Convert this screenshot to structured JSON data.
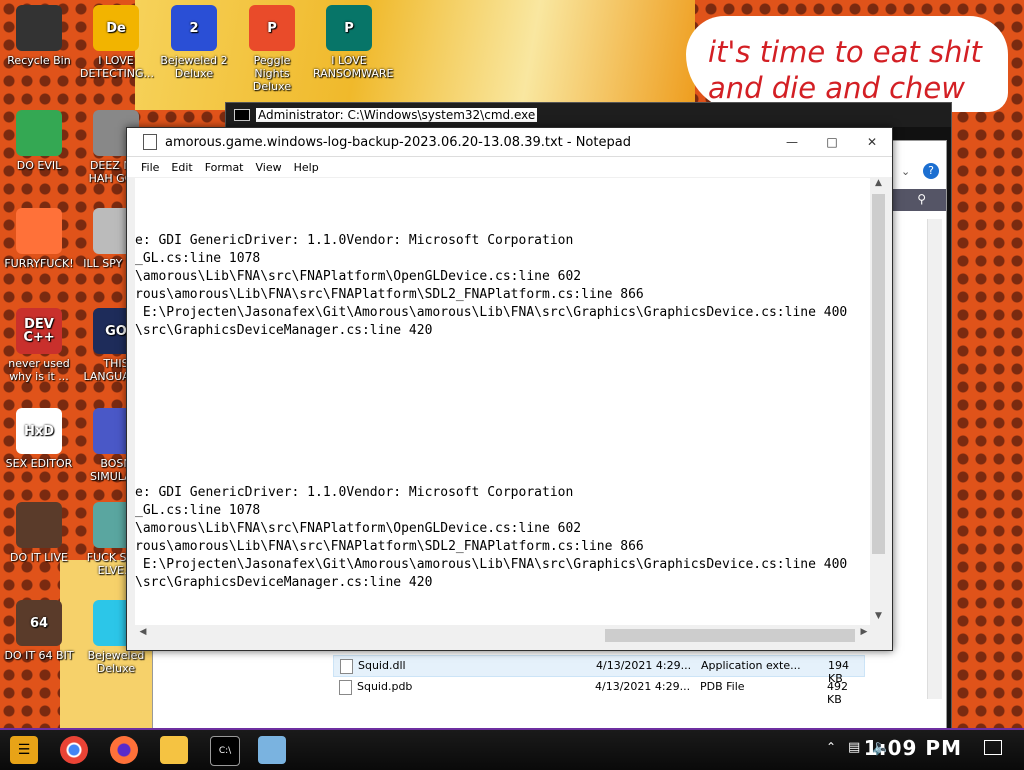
{
  "colors": {
    "accent": "#6d2fa0",
    "speech_text": "#d31f24",
    "desktop_bg": "#e0531a"
  },
  "speech_text": "it's time to eat shit and die and chew",
  "desktop_icons": [
    {
      "label": "Recycle Bin",
      "icon": "recycle-bin-icon",
      "color": "#333"
    },
    {
      "label": "I LOVE DETECTING...",
      "icon": "de-icon",
      "color": "#f2b400",
      "glyph": "De"
    },
    {
      "label": "Bejeweled 2 Deluxe",
      "icon": "bejeweled-icon",
      "color": "#2a4fd6",
      "glyph": "2"
    },
    {
      "label": "Peggle Nights Deluxe",
      "icon": "peggle-icon",
      "color": "#e94b2a",
      "glyph": "P"
    },
    {
      "label": "I LOVE RANSOMWARE",
      "icon": "publisher-icon",
      "color": "#077568",
      "glyph": "P"
    },
    {
      "label": "DO EVIL",
      "icon": "chrome-icon",
      "color": "#34a853"
    },
    {
      "label": "DEEZ N... HAH GO...",
      "icon": "deez-icon",
      "color": "#888"
    },
    {
      "label": "FURRYFUCK!",
      "icon": "firefox-icon",
      "color": "#ff7139"
    },
    {
      "label": "ILL SPY YOU",
      "icon": "spy-icon",
      "color": "#bbb"
    },
    {
      "label": "never used why is it ...",
      "icon": "devcpp-icon",
      "color": "#c9302c",
      "glyph": "DEV C++"
    },
    {
      "label": "THIS LANGUAG...",
      "icon": "go-icon",
      "color": "#1e2c5a",
      "glyph": "GO"
    },
    {
      "label": "SEX EDITOR",
      "icon": "hxd-icon",
      "color": "#fff",
      "glyph": "HxD"
    },
    {
      "label": "BOSN SIMULA...",
      "icon": "bosn-icon",
      "color": "#4a58c7"
    },
    {
      "label": "DO IT LIVE",
      "icon": "portrait-icon",
      "color": "#5a3b2a"
    },
    {
      "label": "FUCK SO... ELVE...",
      "icon": "elve-icon",
      "color": "#5aa6a0"
    },
    {
      "label": "DO IT 64 BIT",
      "icon": "portrait64-icon",
      "color": "#5a3b2a",
      "glyph": "64"
    },
    {
      "label": "Bejeweled Deluxe",
      "icon": "diamond-icon",
      "color": "#2cc6e8"
    }
  ],
  "cmd": {
    "title": "Administrator: C:\\Windows\\system32\\cmd.exe"
  },
  "explorer": {
    "files": [
      {
        "name": "Squid.dll",
        "date": "4/13/2021 4:29...",
        "type": "Application exte...",
        "size": "194 KB"
      },
      {
        "name": "Squid.pdb",
        "date": "4/13/2021 4:29...",
        "type": "PDB File",
        "size": "492 KB"
      }
    ]
  },
  "notepad": {
    "title": "amorous.game.windows-log-backup-2023.06.20-13.08.39.txt - Notepad",
    "menu": [
      "File",
      "Edit",
      "Format",
      "View",
      "Help"
    ],
    "lines": [
      "",
      "",
      "",
      "e: GDI GenericDriver: 1.1.0Vendor: Microsoft Corporation",
      "_GL.cs:line 1078",
      "\\amorous\\Lib\\FNA\\src\\FNAPlatform\\OpenGLDevice.cs:line 602",
      "rous\\amorous\\Lib\\FNA\\src\\FNAPlatform\\SDL2_FNAPlatform.cs:line 866",
      " E:\\Projecten\\Jasonafex\\Git\\Amorous\\amorous\\Lib\\FNA\\src\\Graphics\\GraphicsDevice.cs:line 400",
      "\\src\\GraphicsDeviceManager.cs:line 420",
      "",
      "",
      "",
      "",
      "",
      "",
      "",
      "",
      "e: GDI GenericDriver: 1.1.0Vendor: Microsoft Corporation",
      "_GL.cs:line 1078",
      "\\amorous\\Lib\\FNA\\src\\FNAPlatform\\OpenGLDevice.cs:line 602",
      "rous\\amorous\\Lib\\FNA\\src\\FNAPlatform\\SDL2_FNAPlatform.cs:line 866",
      " E:\\Projecten\\Jasonafex\\Git\\Amorous\\amorous\\Lib\\FNA\\src\\Graphics\\GraphicsDevice.cs:line 400",
      "\\src\\GraphicsDeviceManager.cs:line 420"
    ]
  },
  "taskbar": {
    "clock": "1:09 PM"
  }
}
